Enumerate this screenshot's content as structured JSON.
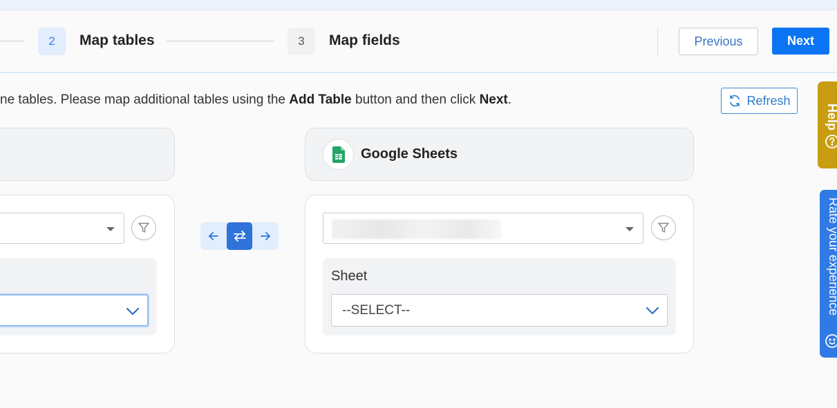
{
  "stepper": {
    "steps": [
      {
        "number": "2",
        "label": "Map tables",
        "state": "active"
      },
      {
        "number": "3",
        "label": "Map fields",
        "state": "inactive"
      }
    ]
  },
  "toolbar": {
    "previous_label": "Previous",
    "next_label": "Next"
  },
  "instructions": {
    "part1": "ne tables. Please map additional tables using the ",
    "bold1": "Add Table",
    "part2": " button and then click ",
    "bold2": "Next",
    "part3": "."
  },
  "refresh": {
    "label": "Refresh",
    "icon": "refresh-icon"
  },
  "target": {
    "title": "Google Sheets",
    "logo": "google-sheets-logo",
    "sheet_label": "Sheet",
    "sheet_select": "--SELECT--"
  },
  "swap": {
    "left_icon": "arrow-left-icon",
    "center_icon": "swap-icon",
    "right_icon": "arrow-right-icon"
  },
  "side_tabs": {
    "help_label": "Help",
    "rate_label": "Rate your experience"
  },
  "colors": {
    "primary": "#0a74f3",
    "accent_light": "#e2edfd",
    "help_tab": "#c99d10",
    "rate_tab": "#2f7ae5",
    "sheets_green": "#23a566"
  }
}
